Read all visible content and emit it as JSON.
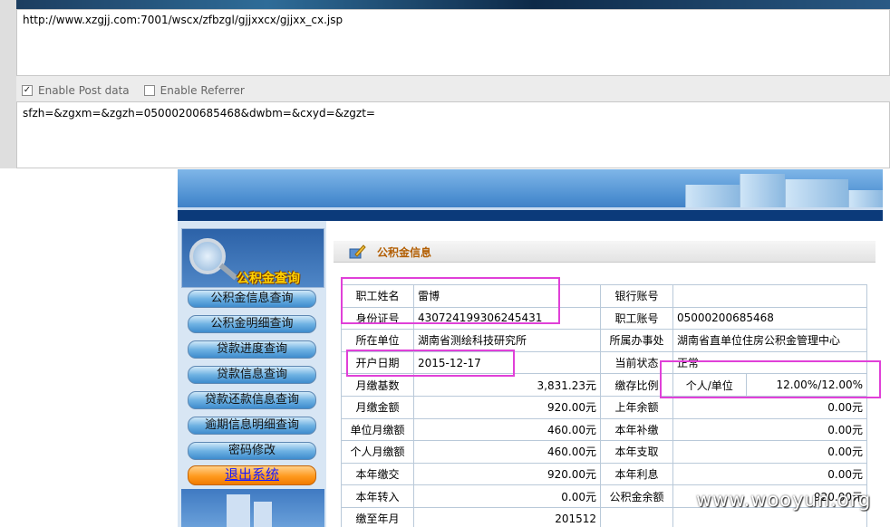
{
  "request": {
    "url": "http://www.xzgjj.com:7001/wscx/zfbzgl/gjjxxcx/gjjxx_cx.jsp",
    "enable_post_label": "Enable Post data",
    "enable_post_checked": true,
    "enable_referrer_label": "Enable Referrer",
    "enable_referrer_checked": false,
    "post_data": "sfzh=&zgxm=&zgzh=05000200685468&dwbm=&cxyd=&zgzt="
  },
  "sidebar": {
    "logo_title": "公积金查询",
    "items": [
      {
        "label": "公积金信息查询"
      },
      {
        "label": "公积金明细查询"
      },
      {
        "label": "贷款进度查询"
      },
      {
        "label": "贷款信息查询"
      },
      {
        "label": "贷款还款信息查询"
      },
      {
        "label": "逾期信息明细查询"
      },
      {
        "label": "密码修改"
      }
    ],
    "logout_label": "退出系统"
  },
  "main": {
    "section_title": "公积金信息",
    "rows": [
      {
        "l1": "职工姓名",
        "v1": "雷博",
        "l2": "银行账号",
        "v2": ""
      },
      {
        "l1": "身份证号",
        "v1": "430724199306245431",
        "l2": "职工账号",
        "v2": "05000200685468"
      },
      {
        "l1": "所在单位",
        "v1": "湖南省测绘科技研究所",
        "l2": "所属办事处",
        "v2": "湖南省直单位住房公积金管理中心"
      },
      {
        "l1": "开户日期",
        "v1": "2015-12-17",
        "l2": "当前状态",
        "v2": "正常"
      },
      {
        "l1": "月缴基数",
        "v1": "3,831.23元",
        "l2": "缴存比例",
        "v2a": "个人/单位",
        "v2": "12.00%/12.00%"
      },
      {
        "l1": "月缴金额",
        "v1": "920.00元",
        "l2": "上年余额",
        "v2": "0.00元"
      },
      {
        "l1": "单位月缴额",
        "v1": "460.00元",
        "l2": "本年补缴",
        "v2": "0.00元"
      },
      {
        "l1": "个人月缴额",
        "v1": "460.00元",
        "l2": "本年支取",
        "v2": "0.00元"
      },
      {
        "l1": "本年缴交",
        "v1": "920.00元",
        "l2": "本年利息",
        "v2": "0.00元"
      },
      {
        "l1": "本年转入",
        "v1": "0.00元",
        "l2": "公积金余额",
        "v2": "920.00元"
      },
      {
        "l1": "缴至年月",
        "v1": "201512",
        "l2": "",
        "v2": ""
      }
    ]
  },
  "watermark": "www.wooyun.org"
}
